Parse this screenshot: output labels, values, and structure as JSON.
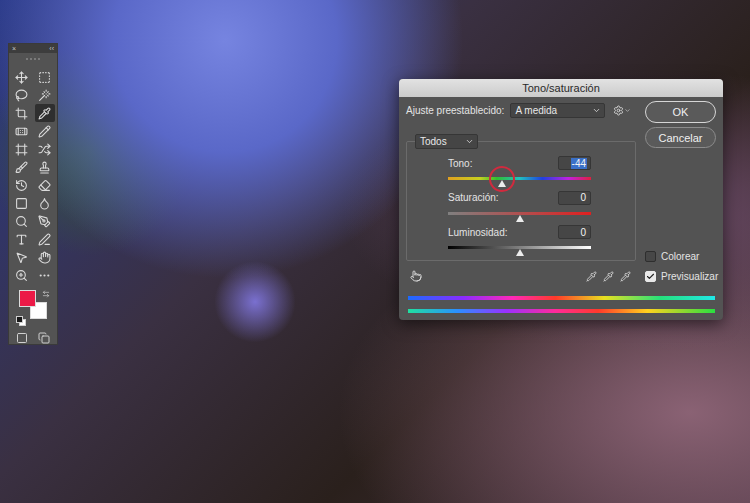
{
  "toolbar": {
    "header": {
      "close": "×",
      "collapse": "‹‹"
    },
    "tools": [
      {
        "selected": false
      },
      {
        "selected": false
      },
      {
        "selected": false
      },
      {
        "selected": false
      },
      {
        "selected": false
      },
      {
        "selected": true
      },
      {
        "selected": false
      },
      {
        "selected": false
      },
      {
        "selected": false
      },
      {
        "selected": false
      },
      {
        "selected": false
      },
      {
        "selected": false
      },
      {
        "selected": false
      },
      {
        "selected": false
      },
      {
        "selected": false
      },
      {
        "selected": false
      },
      {
        "selected": false
      },
      {
        "selected": false
      },
      {
        "selected": false
      },
      {
        "selected": false
      },
      {
        "selected": false
      },
      {
        "selected": false
      },
      {
        "selected": false
      },
      {
        "selected": false
      }
    ],
    "colors": {
      "foreground": "#ec1a47",
      "background": "#ffffff"
    }
  },
  "dialog": {
    "title": "Tono/saturación",
    "preset": {
      "label": "Ajuste preestablecido:",
      "value": "A medida"
    },
    "buttons": [
      {
        "label": "OK",
        "default": true
      },
      {
        "label": "Cancelar",
        "default": false
      }
    ],
    "channel": "Todos",
    "sliders": [
      {
        "label": "Tono:",
        "value": "-44",
        "level": 0.378,
        "kind": "hue",
        "highlighted": true,
        "circled": true
      },
      {
        "label": "Saturación:",
        "value": "0",
        "level": 0.5,
        "kind": "saturation",
        "highlighted": false,
        "circled": false
      },
      {
        "label": "Luminosidad:",
        "value": "0",
        "level": 0.5,
        "kind": "lightness",
        "highlighted": false,
        "circled": false
      }
    ],
    "options": [
      {
        "label": "Colorear",
        "checked": false
      },
      {
        "label": "Previsualizar",
        "checked": true
      }
    ]
  },
  "annotation": {
    "color": "#d12a3e"
  }
}
